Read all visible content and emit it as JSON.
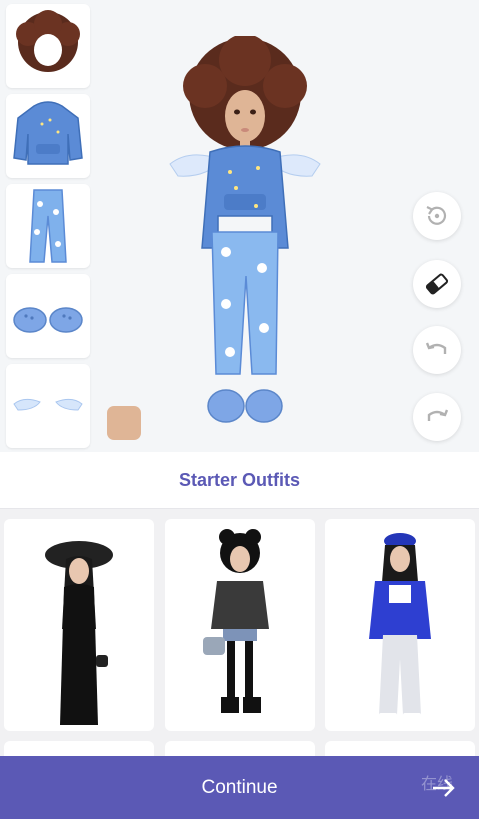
{
  "theme": {
    "accent": "#5b59b5",
    "skin_tone": "#dfb596",
    "stage_bg": "#f4f6f8"
  },
  "closet": {
    "items": [
      {
        "name": "afro hair",
        "icon": "hair-icon"
      },
      {
        "name": "blue hoodie",
        "icon": "hoodie-icon"
      },
      {
        "name": "cloud print pants",
        "icon": "pants-icon"
      },
      {
        "name": "blue clogs",
        "icon": "clogs-icon"
      },
      {
        "name": "angel wings",
        "icon": "wings-icon"
      }
    ]
  },
  "tools": [
    {
      "icon": "reset-icon",
      "active": false
    },
    {
      "icon": "eraser-icon",
      "active": true
    },
    {
      "icon": "undo-icon",
      "active": false
    },
    {
      "icon": "redo-icon",
      "active": false
    }
  ],
  "section": {
    "title": "Starter Outfits"
  },
  "outfits": [
    {
      "style": "black gothic gown with fur hat"
    },
    {
      "style": "grunge oversized sweatshirt and plaid skirt"
    },
    {
      "style": "blue varsity jacket and ripped jeans"
    }
  ],
  "footer": {
    "continue_label": "Continue",
    "arrow_icon": "arrow-right-icon"
  },
  "watermark": "在线"
}
